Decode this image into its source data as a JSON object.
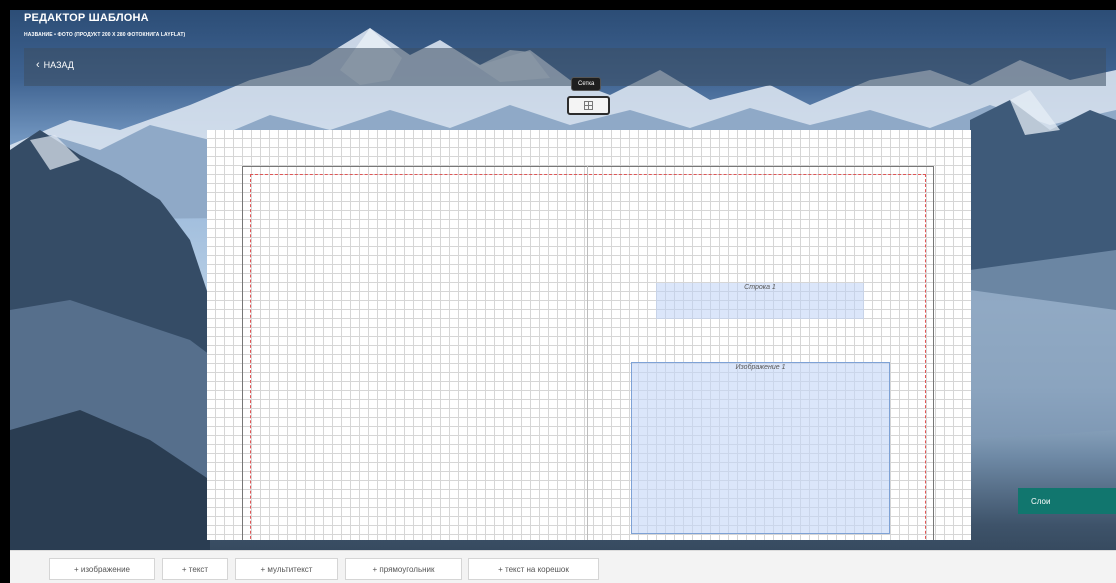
{
  "header": {
    "title": "РЕДАКТОР ШАБЛОНА",
    "subtitle": "НАЗВАНИЕ • ФОТО (ПРОДУКТ 200 X 280 ФОТОКНИГА LAYFLAT)",
    "back_label": "НАЗАД"
  },
  "grid_toggle": {
    "tooltip": "Сетка",
    "icon": "grid-icon"
  },
  "canvas": {
    "elements": [
      {
        "type": "text",
        "label": "Строка 1"
      },
      {
        "type": "image",
        "label": "Изображение 1"
      }
    ]
  },
  "layers_button": "Слои",
  "toolbar": {
    "buttons": [
      "+ изображение",
      "+ текст",
      "+ мультитекст",
      "+ прямоугольник",
      "+ текст на корешок"
    ]
  },
  "colors": {
    "accent": "#11766e",
    "safe_zone": "#e05555",
    "element_fill": "#c3d5f7"
  }
}
